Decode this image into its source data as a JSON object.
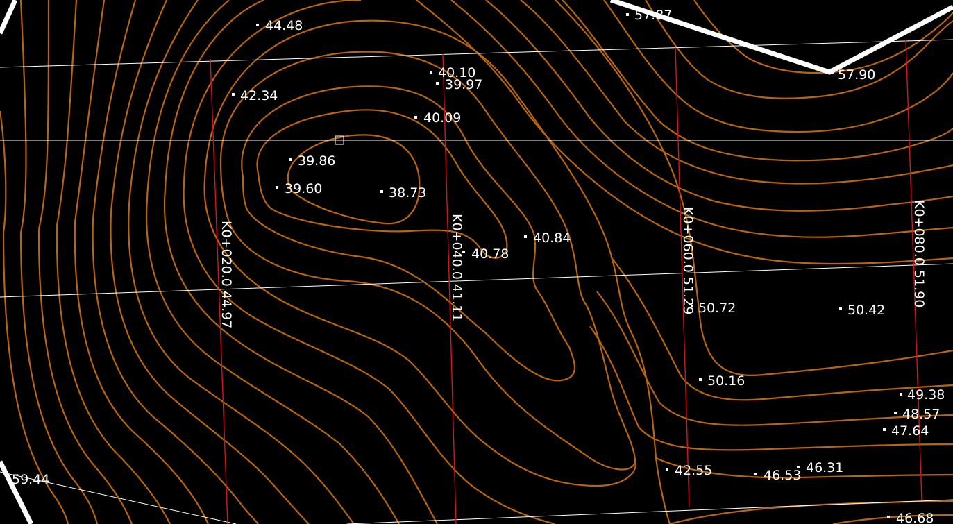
{
  "colors": {
    "background": "#000000",
    "contour": "#b8650f",
    "grid_line": "#ffffff",
    "station_line": "#d9141e",
    "boundary": "#ffffff",
    "text": "#ffffff"
  },
  "spot_elevations": [
    {
      "label": "44.48"
    },
    {
      "label": "57.87"
    },
    {
      "label": "57.90"
    },
    {
      "label": "40.10"
    },
    {
      "label": "39.97"
    },
    {
      "label": "42.34"
    },
    {
      "label": "40.09"
    },
    {
      "label": "39.86"
    },
    {
      "label": "39.60"
    },
    {
      "label": "38.73"
    },
    {
      "label": "40.84"
    },
    {
      "label": "40.78"
    },
    {
      "label": "50.72"
    },
    {
      "label": "50.42"
    },
    {
      "label": "50.16"
    },
    {
      "label": "49.38"
    },
    {
      "label": "48.57"
    },
    {
      "label": "47.64"
    },
    {
      "label": "42.55"
    },
    {
      "label": "46.53"
    },
    {
      "label": "46.31"
    },
    {
      "label": "46.68"
    },
    {
      "label": "59.44"
    }
  ],
  "stations": [
    {
      "label": "K0+020.0 44.97"
    },
    {
      "label": "K0+040.0 41.11"
    },
    {
      "label": "K0+060.0 51.29"
    },
    {
      "label": "K0+080.0 51.90"
    }
  ]
}
